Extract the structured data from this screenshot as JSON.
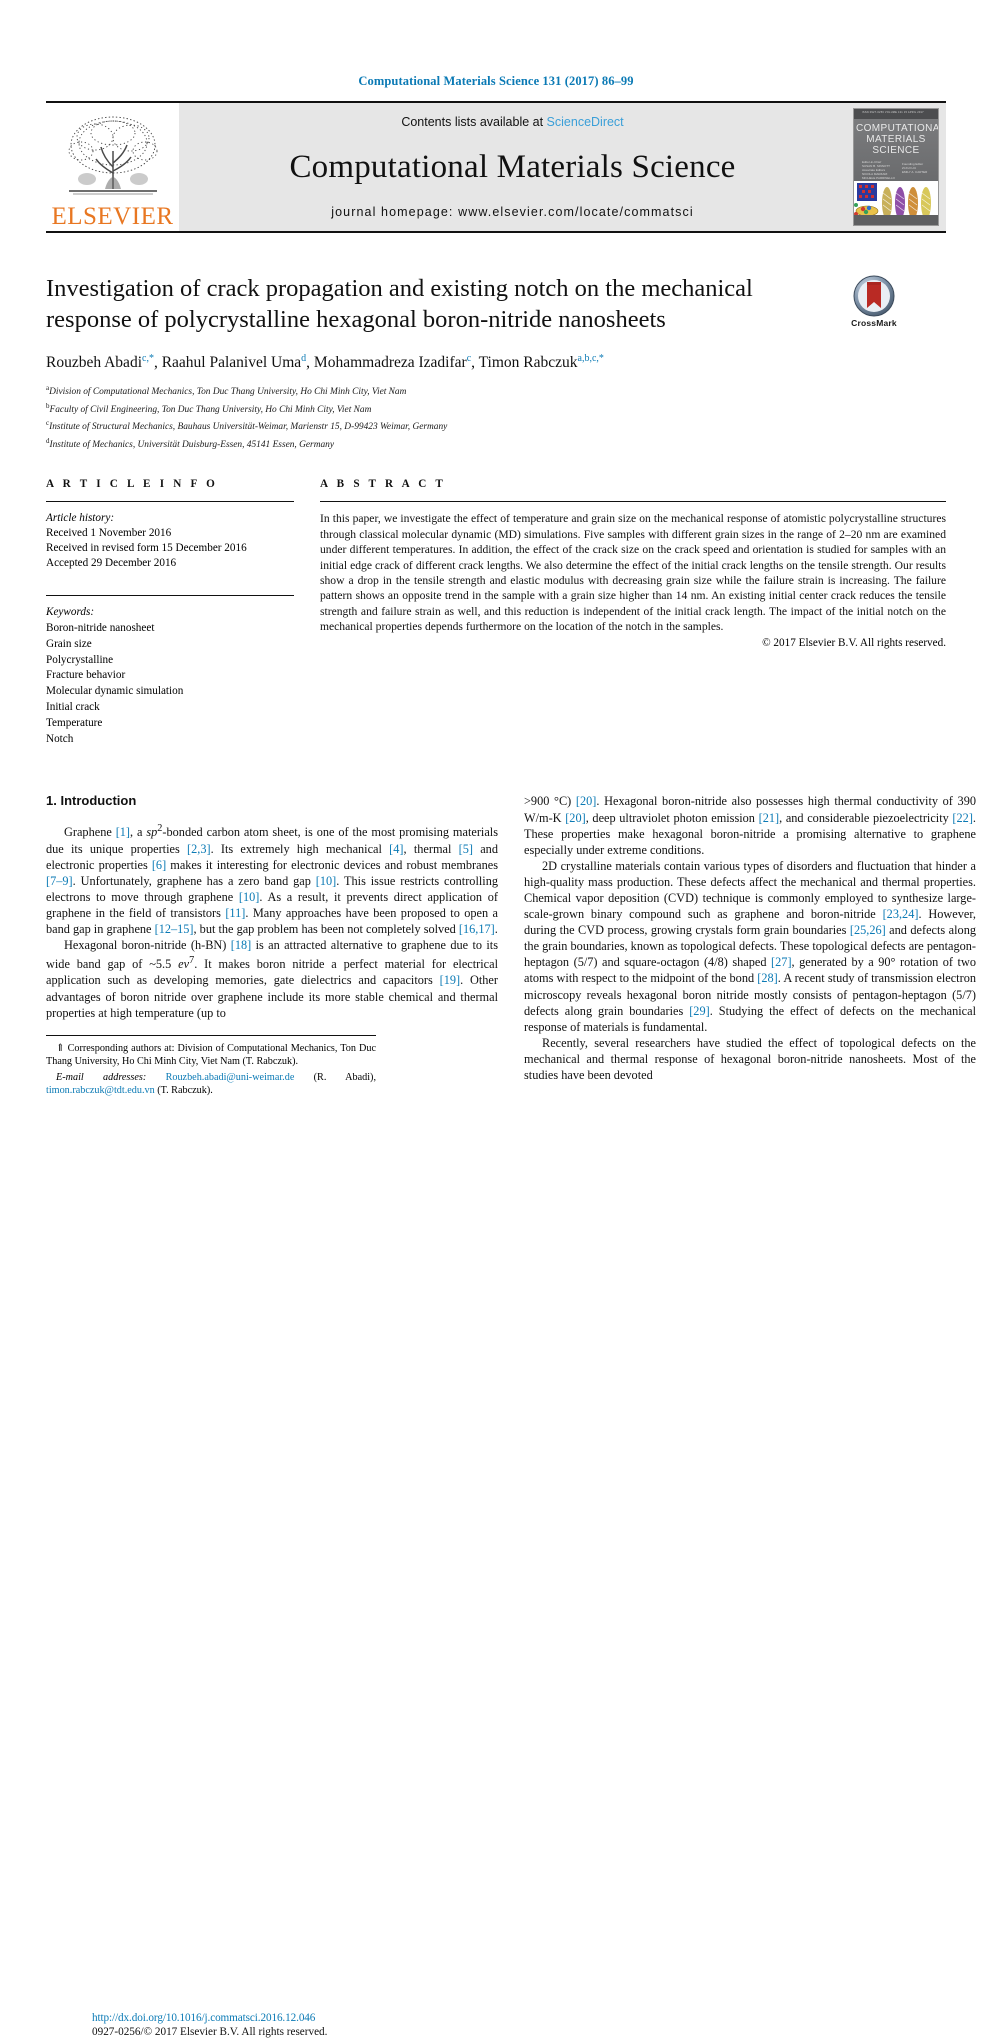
{
  "running_head": "Computational Materials Science 131 (2017) 86–99",
  "masthead": {
    "publisher_logo_label": "ELSEVIER",
    "contents_prefix": "Contents lists available at ",
    "contents_link": "ScienceDirect",
    "journal_title": "Computational Materials Science",
    "homepage": "journal homepage: www.elsevier.com/locate/commatsci",
    "cover": {
      "top_micro_text": "ISSN 0927-0256  VOLUME 131  15 APRIL 2017",
      "title_lines": [
        "COMPUTATIONAL",
        "MATERIALS",
        "SCIENCE"
      ],
      "editors_col1": [
        "Editor-in-Chief",
        "SUSAN B. SINNOTT",
        "Associate Editors",
        "NICOLA MARZARI",
        "MICHELE PARRINELLO",
        "DAVID J. SROLOVITZ"
      ],
      "editors_col2": [
        "Founding Editor",
        "ZI-KUI LIU",
        "EMILY A. CARTER"
      ],
      "footer_text": "Available online at www.sciencedirect.com",
      "footer_brand": "ScienceDirect"
    }
  },
  "article": {
    "title": "Investigation of crack propagation and existing notch on the mechanical response of polycrystalline hexagonal boron-nitride nanosheets",
    "crossmark_label": "CrossMark",
    "authors": [
      {
        "name": "Rouzbeh Abadi",
        "marks": "c,*"
      },
      {
        "name": "Raahul Palanivel Uma",
        "marks": "d"
      },
      {
        "name": "Mohammadreza Izadifar",
        "marks": "c"
      },
      {
        "name": "Timon Rabczuk",
        "marks": "a,b,c,*"
      }
    ],
    "affiliations": [
      {
        "mark": "a",
        "text": "Division of Computational Mechanics, Ton Duc Thang University, Ho Chi Minh City, Viet Nam"
      },
      {
        "mark": "b",
        "text": "Faculty of Civil Engineering, Ton Duc Thang University, Ho Chi Minh City, Viet Nam"
      },
      {
        "mark": "c",
        "text": "Institute of Structural Mechanics, Bauhaus Universität-Weimar, Marienstr 15, D-99423 Weimar, Germany"
      },
      {
        "mark": "d",
        "text": "Institute of Mechanics, Universität Duisburg-Essen, 45141 Essen, Germany"
      }
    ]
  },
  "article_info": {
    "heading": "A R T I C L E   I N F O",
    "history_label": "Article history:",
    "history": [
      "Received 1 November 2016",
      "Received in revised form 15 December 2016",
      "Accepted 29 December 2016"
    ],
    "keywords_label": "Keywords:",
    "keywords": [
      "Boron-nitride nanosheet",
      "Grain size",
      "Polycrystalline",
      "Fracture behavior",
      "Molecular dynamic simulation",
      "Initial crack",
      "Temperature",
      "Notch"
    ]
  },
  "abstract": {
    "heading": "A B S T R A C T",
    "text": "In this paper, we investigate the effect of temperature and grain size on the mechanical response of atomistic polycrystalline structures through classical molecular dynamic (MD) simulations. Five samples with different grain sizes in the range of 2–20 nm are examined under different temperatures. In addition, the effect of the crack size on the crack speed and orientation is studied for samples with an initial edge crack of different crack lengths. We also determine the effect of the initial crack lengths on the tensile strength. Our results show a drop in the tensile strength and elastic modulus with decreasing grain size while the failure strain is increasing. The failure pattern shows an opposite trend in the sample with a grain size higher than 14 nm. An existing initial center crack reduces the tensile strength and failure strain as well, and this reduction is independent of the initial crack length. The impact of the initial notch on the mechanical properties depends furthermore on the location of the notch in the samples.",
    "copyright": "© 2017 Elsevier B.V. All rights reserved."
  },
  "introduction": {
    "heading": "1. Introduction",
    "left_paragraphs": [
      "Graphene [1], a sp2-bonded carbon atom sheet, is one of the most promising materials due its unique properties [2,3]. Its extremely high mechanical [4], thermal [5] and electronic properties [6] makes it interesting for electronic devices and robust membranes [7–9]. Unfortunately, graphene has a zero band gap [10]. This issue restricts controlling electrons to move through graphene [10]. As a result, it prevents direct application of graphene in the field of transistors [11]. Many approaches have been proposed to open a band gap in graphene [12–15], but the gap problem has been not completely solved [16,17].",
      "Hexagonal boron-nitride (h-BN) [18] is an attracted alternative to graphene due to its wide band gap of ~5.5 ev7. It makes boron nitride a perfect material for electrical application such as developing memories, gate dielectrics and capacitors [19]. Other advantages of boron nitride over graphene include its more stable chemical and thermal properties at high temperature (up to"
    ],
    "right_paragraphs": [
      ">900 °C) [20]. Hexagonal boron-nitride also possesses high thermal conductivity of 390 W/m-K [20], deep ultraviolet photon emission [21], and considerable piezoelectricity [22]. These properties make hexagonal boron-nitride a promising alternative to graphene especially under extreme conditions.",
      "2D crystalline materials contain various types of disorders and fluctuation that hinder a high-quality mass production. These defects affect the mechanical and thermal properties. Chemical vapor deposition (CVD) technique is commonly employed to synthesize large-scale-grown binary compound such as graphene and boron-nitride [23,24]. However, during the CVD process, growing crystals form grain boundaries [25,26] and defects along the grain boundaries, known as topological defects. These topological defects are pentagon-heptagon (5/7) and square-octagon (4/8) shaped [27], generated by a 90° rotation of two atoms with respect to the midpoint of the bond [28]. A recent study of transmission electron microscopy reveals hexagonal boron nitride mostly consists of pentagon-heptagon (5/7) defects along grain boundaries [29]. Studying the effect of defects on the mechanical response of materials is fundamental.",
      "Recently, several researchers have studied the effect of topological defects on the mechanical and thermal response of hexagonal boron-nitride nanosheets. Most of the studies have been devoted"
    ]
  },
  "footnote": {
    "corresponding": "⇑ Corresponding authors at: Division of Computational Mechanics, Ton Duc Thang University, Ho Chi Minh City, Viet Nam (T. Rabczuk).",
    "email_label": "E-mail addresses:",
    "email_1": "Rouzbeh.abadi@uni-weimar.de",
    "email_1_owner": " (R. Abadi), ",
    "email_2": "timon.rabczuk@tdt.edu.vn",
    "email_2_owner": " (T. Rabczuk)."
  },
  "footer": {
    "doi": "http://dx.doi.org/10.1016/j.commatsci.2016.12.046",
    "issn": "0927-0256/© 2017 Elsevier B.V. All rights reserved."
  },
  "colors": {
    "link": "#0b7ab5",
    "elsevier_orange": "#E87722",
    "sciencedirect": "#3a9fd8",
    "masthead_bg": "#e6e6e6"
  }
}
